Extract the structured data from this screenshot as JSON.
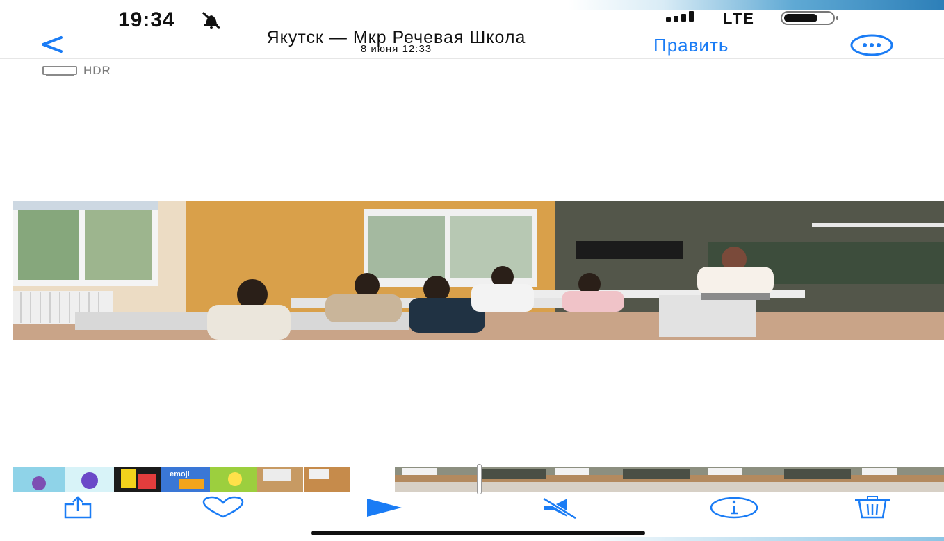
{
  "status_bar": {
    "time": "19:34",
    "network": "LTE",
    "icons": [
      "bell-muted-icon",
      "signal-icon",
      "battery-icon"
    ]
  },
  "nav": {
    "title": "Якутск — Мкр Речевая Школа",
    "subtitle": "8 июня 12:33",
    "edit_label": "Править",
    "icons": [
      "back-chevron-icon",
      "more-ellipsis-icon"
    ]
  },
  "badge": {
    "hdr_label": "HDR"
  },
  "photo": {
    "alt_icon": "photo-classroom"
  },
  "filmstrip": {
    "emoji_thumb_label": "emoji"
  },
  "toolbar": {
    "icons": [
      "share-icon",
      "heart-icon",
      "play-icon",
      "mute-icon",
      "info-icon",
      "trash-icon"
    ]
  },
  "colors": {
    "accent": "#1a7cf5",
    "toolbar_icon": "#1a7cf5"
  }
}
